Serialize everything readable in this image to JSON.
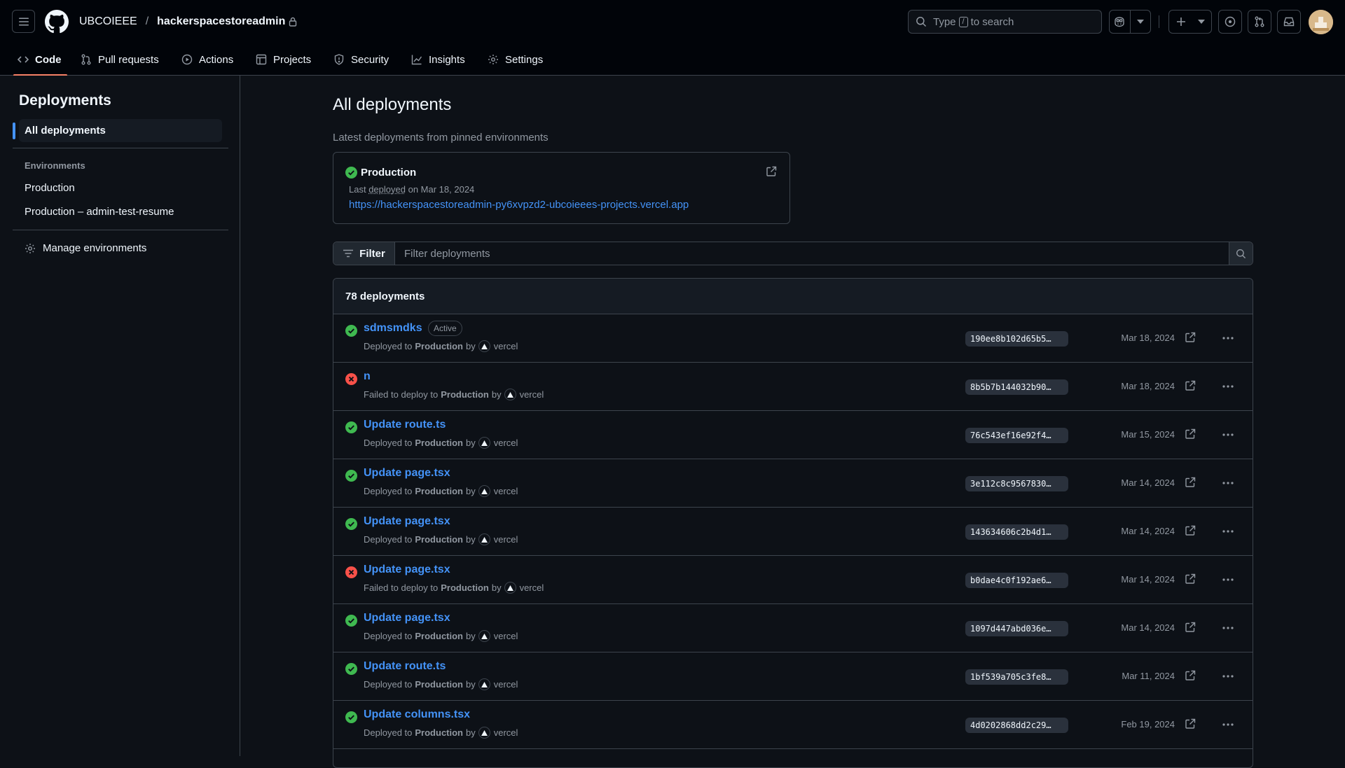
{
  "header": {
    "owner": "UBCOIEEE",
    "separator": "/",
    "repo": "hackerspacestoreadmin",
    "search_prefix": "Type",
    "search_key": "/",
    "search_suffix": "to search"
  },
  "tabs": [
    {
      "label": "Code",
      "icon": "code-icon",
      "active": true
    },
    {
      "label": "Pull requests",
      "icon": "git-pull-request-icon"
    },
    {
      "label": "Actions",
      "icon": "play-icon"
    },
    {
      "label": "Projects",
      "icon": "table-icon"
    },
    {
      "label": "Security",
      "icon": "shield-icon"
    },
    {
      "label": "Insights",
      "icon": "graph-icon"
    },
    {
      "label": "Settings",
      "icon": "gear-icon"
    }
  ],
  "sidebar": {
    "title": "Deployments",
    "all_label": "All deployments",
    "environments_heading": "Environments",
    "environments": [
      "Production",
      "Production – admin-test-resume"
    ],
    "manage_label": "Manage environments"
  },
  "main": {
    "title": "All deployments",
    "subtitle": "Latest deployments from pinned environments",
    "pinned": {
      "name": "Production",
      "meta_prefix": "Last",
      "meta_link": "deployed",
      "meta_suffix": "on Mar 18, 2024",
      "url": "https://hackerspacestoreadmin-py6xvpzd2-ubcoieees-projects.vercel.app"
    },
    "filter_label": "Filter",
    "filter_placeholder": "Filter deployments",
    "count_label": "78 deployments"
  },
  "deployments": [
    {
      "title": "sdmsmdks",
      "badge": "Active",
      "status": "success",
      "action": "Deployed to",
      "env": "Production",
      "by": "by",
      "actor": "vercel",
      "sha": "190ee8b102d65b5…",
      "date": "Mar 18, 2024"
    },
    {
      "title": "n",
      "badge": "",
      "status": "failure",
      "action": "Failed to deploy to",
      "env": "Production",
      "by": "by",
      "actor": "vercel",
      "sha": "8b5b7b144032b90…",
      "date": "Mar 18, 2024"
    },
    {
      "title": "Update route.ts",
      "badge": "",
      "status": "success",
      "action": "Deployed to",
      "env": "Production",
      "by": "by",
      "actor": "vercel",
      "sha": "76c543ef16e92f4…",
      "date": "Mar 15, 2024"
    },
    {
      "title": "Update page.tsx",
      "badge": "",
      "status": "success",
      "action": "Deployed to",
      "env": "Production",
      "by": "by",
      "actor": "vercel",
      "sha": "3e112c8c9567830…",
      "date": "Mar 14, 2024"
    },
    {
      "title": "Update page.tsx",
      "badge": "",
      "status": "success",
      "action": "Deployed to",
      "env": "Production",
      "by": "by",
      "actor": "vercel",
      "sha": "143634606c2b4d1…",
      "date": "Mar 14, 2024"
    },
    {
      "title": "Update page.tsx",
      "badge": "",
      "status": "failure",
      "action": "Failed to deploy to",
      "env": "Production",
      "by": "by",
      "actor": "vercel",
      "sha": "b0dae4c0f192ae6…",
      "date": "Mar 14, 2024"
    },
    {
      "title": "Update page.tsx",
      "badge": "",
      "status": "success",
      "action": "Deployed to",
      "env": "Production",
      "by": "by",
      "actor": "vercel",
      "sha": "1097d447abd036e…",
      "date": "Mar 14, 2024"
    },
    {
      "title": "Update route.ts",
      "badge": "",
      "status": "success",
      "action": "Deployed to",
      "env": "Production",
      "by": "by",
      "actor": "vercel",
      "sha": "1bf539a705c3fe8…",
      "date": "Mar 11, 2024"
    },
    {
      "title": "Update columns.tsx",
      "badge": "",
      "status": "success",
      "action": "Deployed to",
      "env": "Production",
      "by": "by",
      "actor": "vercel",
      "sha": "4d0202868dd2c29…",
      "date": "Feb 19, 2024"
    }
  ],
  "colors": {
    "bg": "#0d1117",
    "header_bg": "#010409",
    "border": "#3d444d",
    "text": "#f0f6fc",
    "muted": "#9198a1",
    "link": "#4493f8",
    "success": "#3fb950",
    "failure": "#f85149",
    "tab_underline": "#f78166"
  }
}
